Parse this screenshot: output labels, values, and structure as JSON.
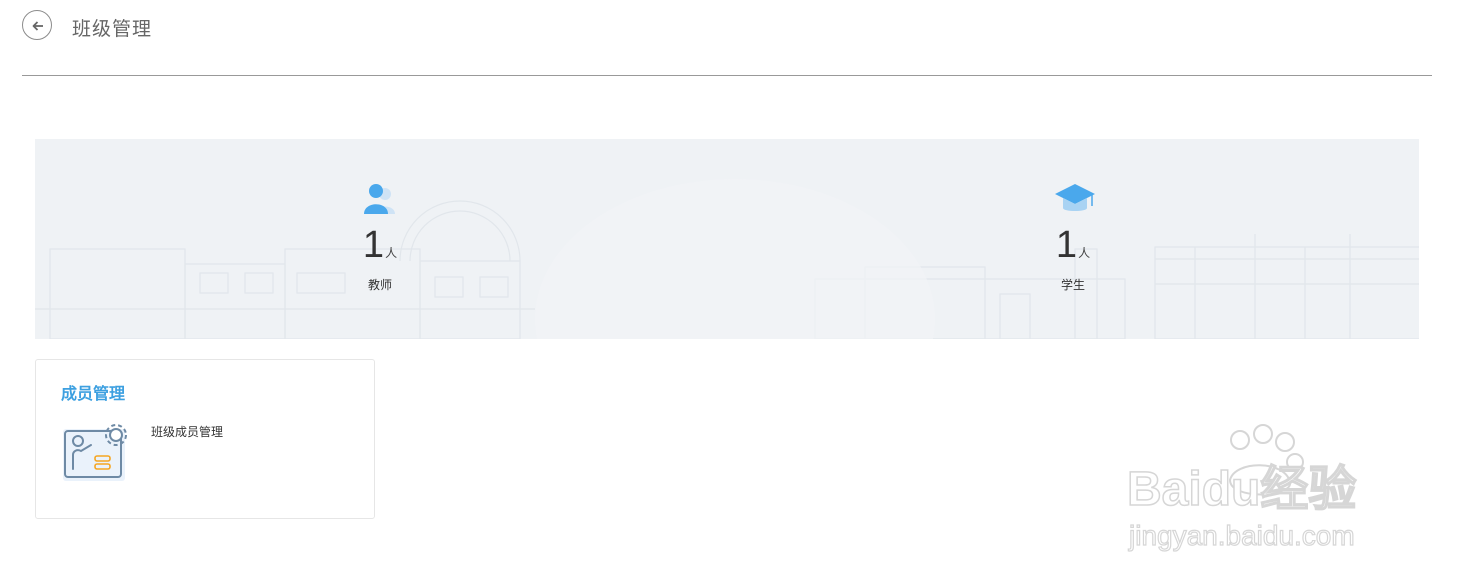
{
  "header": {
    "back_icon": "arrow-left-icon",
    "title": "班级管理"
  },
  "stats": {
    "teacher": {
      "icon": "person-icon",
      "count": "1",
      "unit": "人",
      "label": "教师"
    },
    "student": {
      "icon": "graduation-cap-icon",
      "count": "1",
      "unit": "人",
      "label": "学生"
    }
  },
  "card": {
    "title": "成员管理",
    "item": {
      "icon": "member-settings-icon",
      "label": "班级成员管理"
    }
  },
  "watermark": {
    "brand": "Baidu经验",
    "url": "jingyan.baidu.com"
  },
  "colors": {
    "accent": "#3da0e0",
    "banner_bg": "#eff2f5",
    "icon_blue": "#4aa8ec"
  }
}
